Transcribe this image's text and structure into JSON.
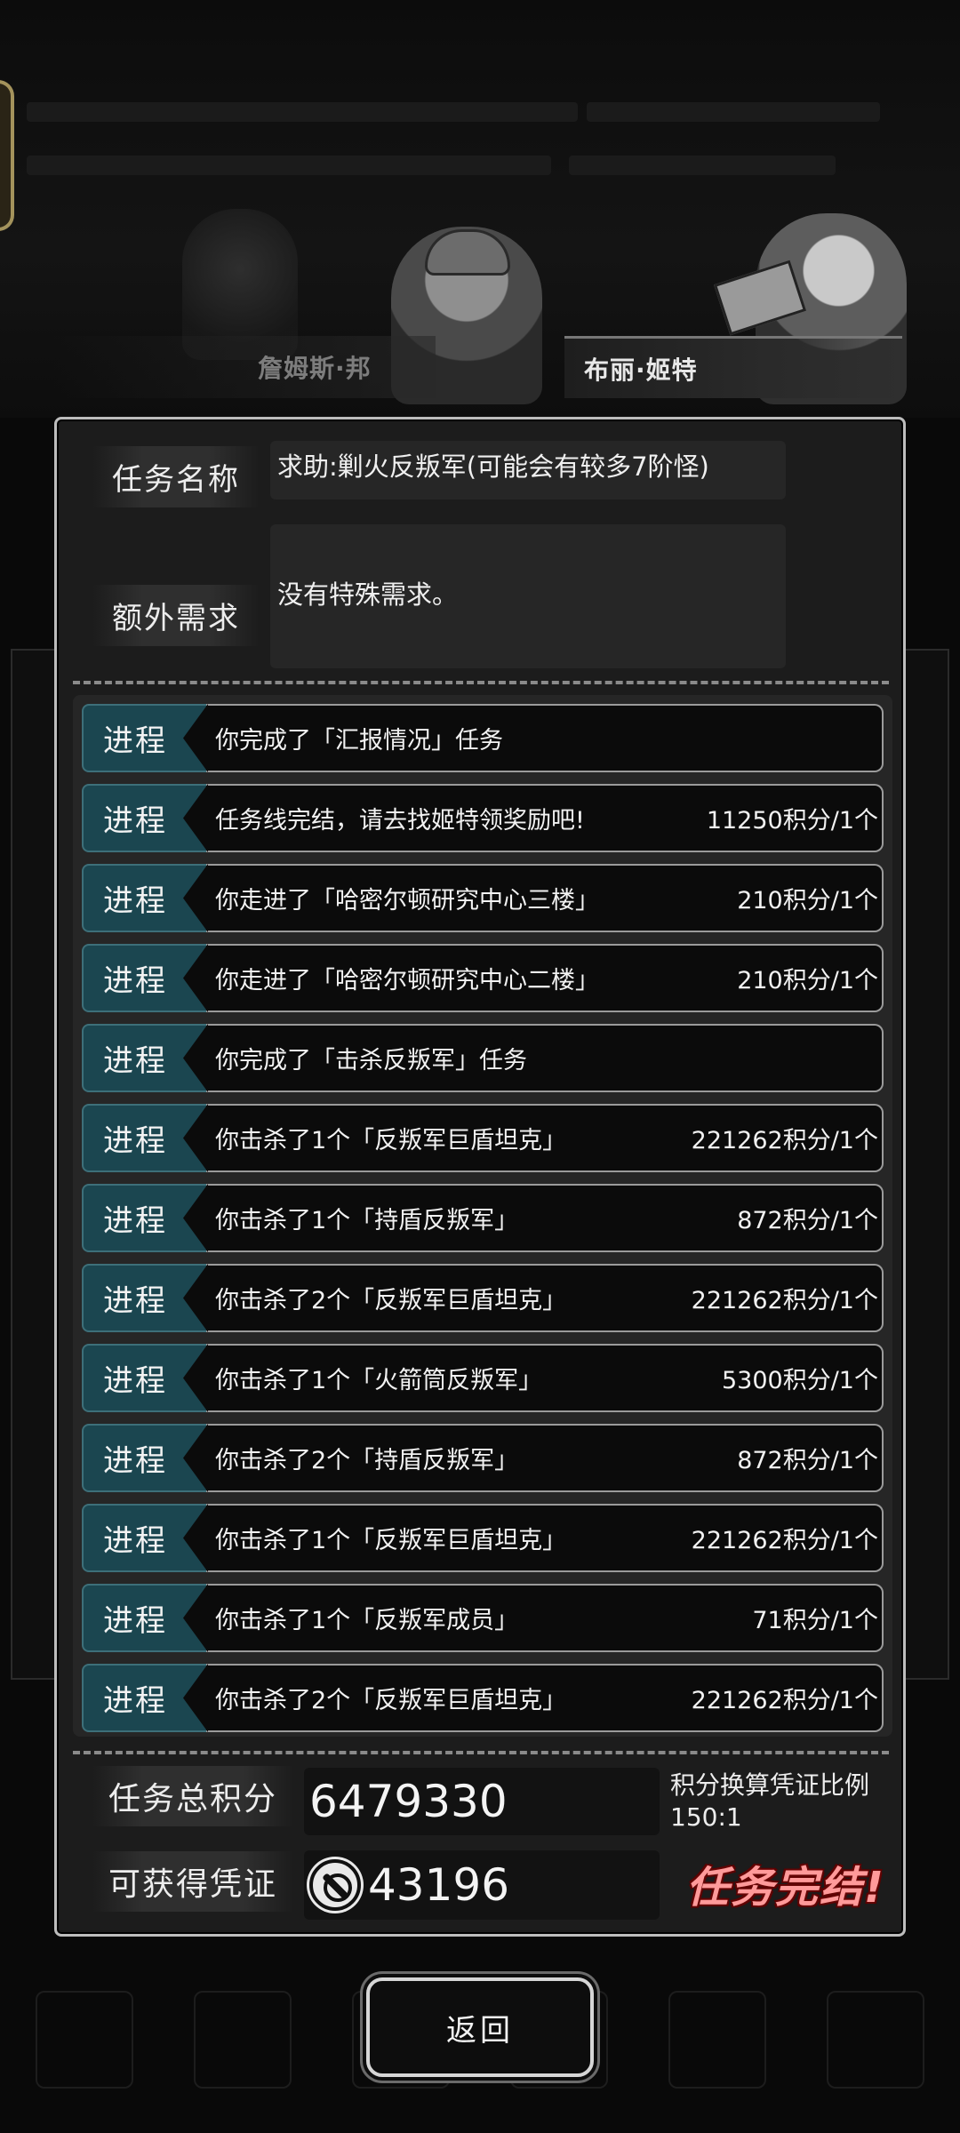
{
  "characters": {
    "left_name": "詹姆斯·邦",
    "right_name": "布丽·姬特"
  },
  "mission": {
    "name_label": "任务名称",
    "name_value": "求助:剿火反叛军(可能会有较多7阶怪)",
    "extra_label": "额外需求",
    "extra_value": "没有特殊需求。"
  },
  "progress": {
    "tag": "进程",
    "rows": [
      {
        "text": "你完成了「汇报情况」任务",
        "points": ""
      },
      {
        "text": "任务线完结，请去找姬特领奖励吧!",
        "points": "11250积分/1个"
      },
      {
        "text": "你走进了「哈密尔顿研究中心三楼」",
        "points": "210积分/1个"
      },
      {
        "text": "你走进了「哈密尔顿研究中心二楼」",
        "points": "210积分/1个"
      },
      {
        "text": "你完成了「击杀反叛军」任务",
        "points": ""
      },
      {
        "text": "你击杀了1个「反叛军巨盾坦克」",
        "points": "221262积分/1个"
      },
      {
        "text": "你击杀了1个「持盾反叛军」",
        "points": "872积分/1个"
      },
      {
        "text": "你击杀了2个「反叛军巨盾坦克」",
        "points": "221262积分/1个"
      },
      {
        "text": "你击杀了1个「火箭筒反叛军」",
        "points": "5300积分/1个"
      },
      {
        "text": "你击杀了2个「持盾反叛军」",
        "points": "872积分/1个"
      },
      {
        "text": "你击杀了1个「反叛军巨盾坦克」",
        "points": "221262积分/1个"
      },
      {
        "text": "你击杀了1个「反叛军成员」",
        "points": "71积分/1个"
      },
      {
        "text": "你击杀了2个「反叛军巨盾坦克」",
        "points": "221262积分/1个"
      }
    ]
  },
  "summary": {
    "total_label": "任务总积分",
    "total_value": "6479330",
    "voucher_label": "可获得凭证",
    "voucher_value": "43196",
    "ratio_label": "积分换算凭证比例",
    "ratio_value": "150:1",
    "status": "任务完结!"
  },
  "buttons": {
    "back": "返回"
  },
  "colors": {
    "tag_bg": "#1b4650",
    "panel_border": "#bdbdbd",
    "status_red": "#ff9a9a"
  }
}
